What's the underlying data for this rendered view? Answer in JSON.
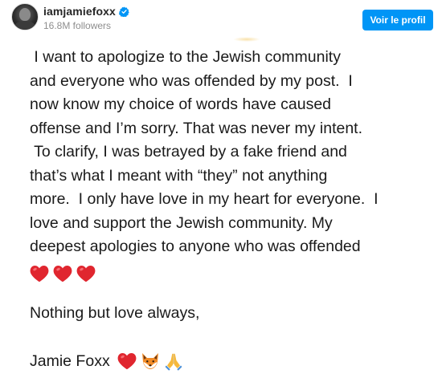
{
  "header": {
    "username": "iamjamiefoxx",
    "followers": "16.8M followers",
    "follow_button_label": "Voir le profil",
    "verified_icon": "verified-badge-icon",
    "accent_color": "#0095f6"
  },
  "post": {
    "lines": [
      " I want to apologize to the Jewish community",
      "and everyone who was offended by my post.  I",
      "now know my choice of words have caused",
      "offense and I’m sorry. That was never my intent.",
      " To clarify, I was betrayed by a fake friend and",
      "that’s what I meant with “they” not anything",
      "more.  I only have love in my heart for everyone.  I",
      "love and support the Jewish community. My",
      "deepest apologies to anyone who was offended"
    ],
    "hearts": [
      "red-heart-icon",
      "red-heart-icon",
      "red-heart-icon"
    ],
    "signoff": "Nothing but love always,",
    "signature": "Jamie Foxx",
    "signature_emojis": [
      "red-heart-icon",
      "fox-face-icon",
      "folded-hands-icon"
    ]
  }
}
